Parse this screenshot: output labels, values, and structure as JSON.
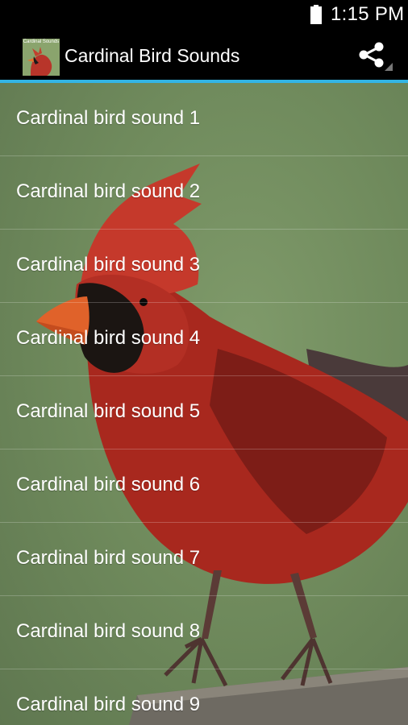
{
  "status_bar": {
    "time": "1:15 PM",
    "battery_icon": "battery-icon"
  },
  "action_bar": {
    "app_icon": "cardinal-app-icon",
    "app_icon_caption": "Cardinal Sounds",
    "title": "Cardinal Bird Sounds",
    "share_icon": "share-icon"
  },
  "colors": {
    "accent": "#33b5e5",
    "background": "#6f8a5c",
    "bird_red": "#c0392b"
  },
  "list": {
    "items": [
      {
        "label": "Cardinal bird sound 1"
      },
      {
        "label": "Cardinal bird sound 2"
      },
      {
        "label": "Cardinal bird sound 3"
      },
      {
        "label": "Cardinal bird sound 4"
      },
      {
        "label": "Cardinal bird sound 5"
      },
      {
        "label": "Cardinal bird sound 6"
      },
      {
        "label": "Cardinal bird sound 7"
      },
      {
        "label": "Cardinal bird sound 8"
      },
      {
        "label": "Cardinal bird sound 9"
      }
    ]
  }
}
